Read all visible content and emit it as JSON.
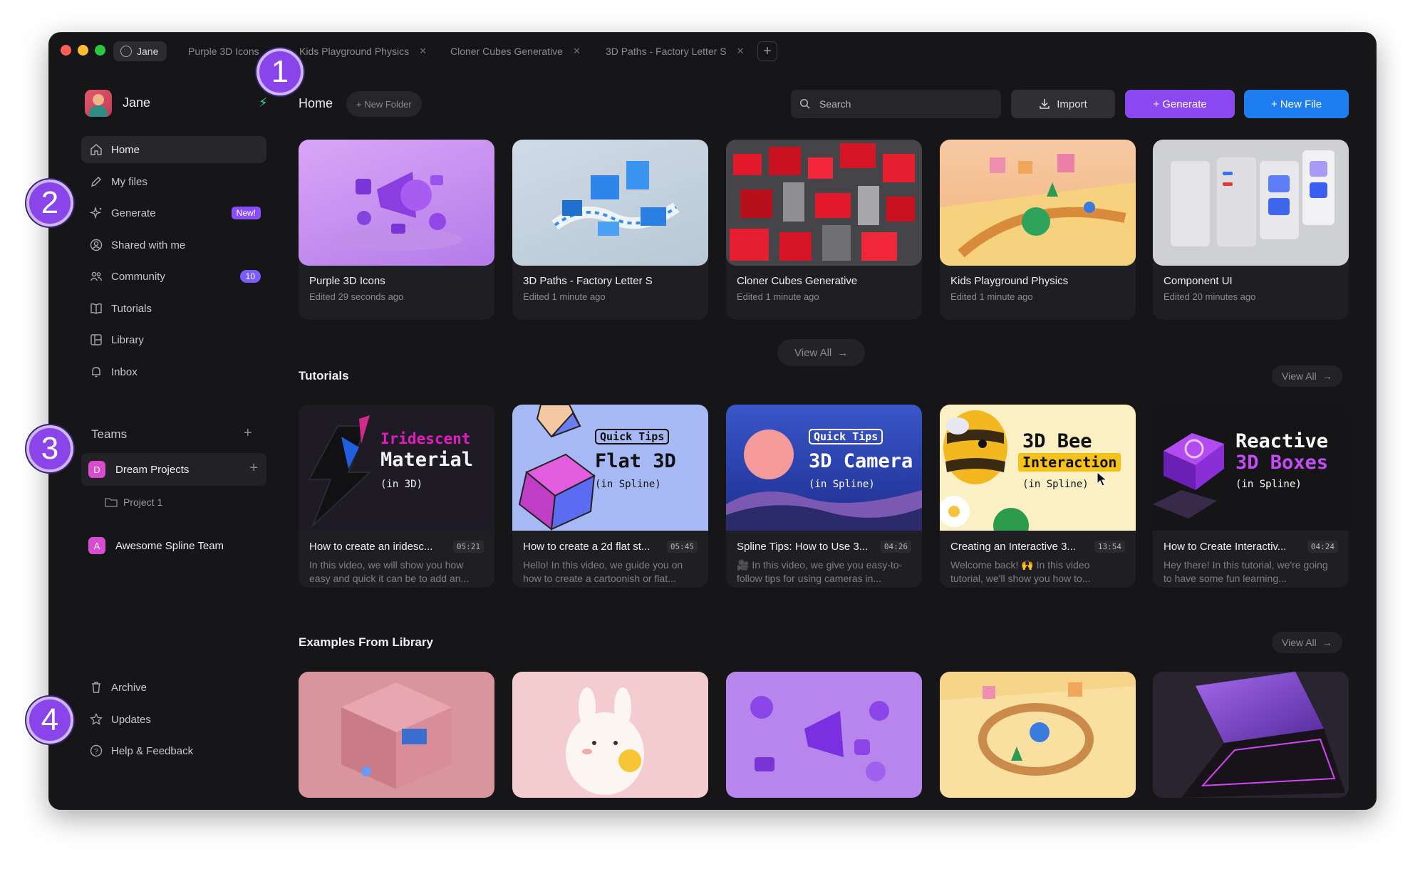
{
  "window": {
    "tabs": [
      {
        "label": "Jane"
      },
      {
        "label": "Purple 3D Icons"
      },
      {
        "label": "Kids Playground Physics"
      },
      {
        "label": "Cloner Cubes Generative"
      },
      {
        "label": "3D Paths - Factory Letter S"
      }
    ]
  },
  "user": {
    "name": "Jane"
  },
  "sidebar": {
    "items": [
      {
        "label": "Home",
        "icon": "home-icon"
      },
      {
        "label": "My files",
        "icon": "pencil-icon"
      },
      {
        "label": "Generate",
        "icon": "sparkle-icon",
        "badge": "New!"
      },
      {
        "label": "Shared with me",
        "icon": "user-circle-icon"
      },
      {
        "label": "Community",
        "icon": "users-icon",
        "badge": "10"
      },
      {
        "label": "Tutorials",
        "icon": "book-icon"
      },
      {
        "label": "Library",
        "icon": "library-icon"
      },
      {
        "label": "Inbox",
        "icon": "bell-icon"
      }
    ],
    "teams_heading": "Teams",
    "teams": [
      {
        "initial": "D",
        "name": "Dream Projects",
        "projects": [
          "Project 1"
        ]
      },
      {
        "initial": "A",
        "name": "Awesome Spline Team"
      }
    ],
    "bottom": [
      {
        "label": "Archive",
        "icon": "trash-icon"
      },
      {
        "label": "Updates",
        "icon": "star-icon"
      },
      {
        "label": "Help & Feedback",
        "icon": "help-icon"
      }
    ]
  },
  "header": {
    "title": "Home",
    "new_folder": "+ New Folder",
    "search_placeholder": "Search",
    "import": "Import",
    "generate": "+ Generate",
    "new_file": "+ New File"
  },
  "recent": [
    {
      "title": "Purple 3D Icons",
      "edited": "Edited 29 seconds ago"
    },
    {
      "title": "3D Paths - Factory Letter S",
      "edited": "Edited 1 minute ago"
    },
    {
      "title": "Cloner Cubes Generative",
      "edited": "Edited 1 minute ago"
    },
    {
      "title": "Kids Playground Physics",
      "edited": "Edited 1 minute ago"
    },
    {
      "title": "Component UI",
      "edited": "Edited 20 minutes ago"
    }
  ],
  "view_all": "View All",
  "tutorials_heading": "Tutorials",
  "tutorials": [
    {
      "title": "How to create an iridesc...",
      "duration": "05:21",
      "desc": "In this video, we will show you how easy and quick it can be to add an...",
      "thumb": {
        "line1": "Iridescent",
        "line2": "Material",
        "line3": "(in 3D)"
      }
    },
    {
      "title": "How to create a 2d flat st...",
      "duration": "05:45",
      "desc": "Hello! In this video, we guide you on how to create a cartoonish or flat...",
      "thumb": {
        "tag": "Quick Tips",
        "line1": "Flat 3D",
        "line2": "(in Spline)"
      }
    },
    {
      "title": "Spline Tips: How to Use 3...",
      "duration": "04:26",
      "desc": "🎥 In this video, we give you easy-to-follow tips for using cameras in...",
      "thumb": {
        "tag": "Quick Tips",
        "line1": "3D Camera",
        "line2": "(in Spline)"
      }
    },
    {
      "title": "Creating an Interactive 3...",
      "duration": "13:54",
      "desc": "Welcome back! 🙌 In this video tutorial, we'll show you how to...",
      "thumb": {
        "line1": "3D Bee",
        "line2": "Interaction",
        "line3": "(in Spline)"
      }
    },
    {
      "title": "How to Create Interactiv...",
      "duration": "04:24",
      "desc": "Hey there! In this tutorial, we're going to have some fun learning...",
      "thumb": {
        "line1": "Reactive",
        "line2": "3D Boxes",
        "line3": "(in Spline)"
      }
    }
  ],
  "examples_heading": "Examples From Library",
  "annotations": [
    "1",
    "2",
    "3",
    "4"
  ],
  "colors": {
    "accent_purple": "#8b48f0",
    "accent_blue": "#1f7df2",
    "background": "#161619"
  }
}
